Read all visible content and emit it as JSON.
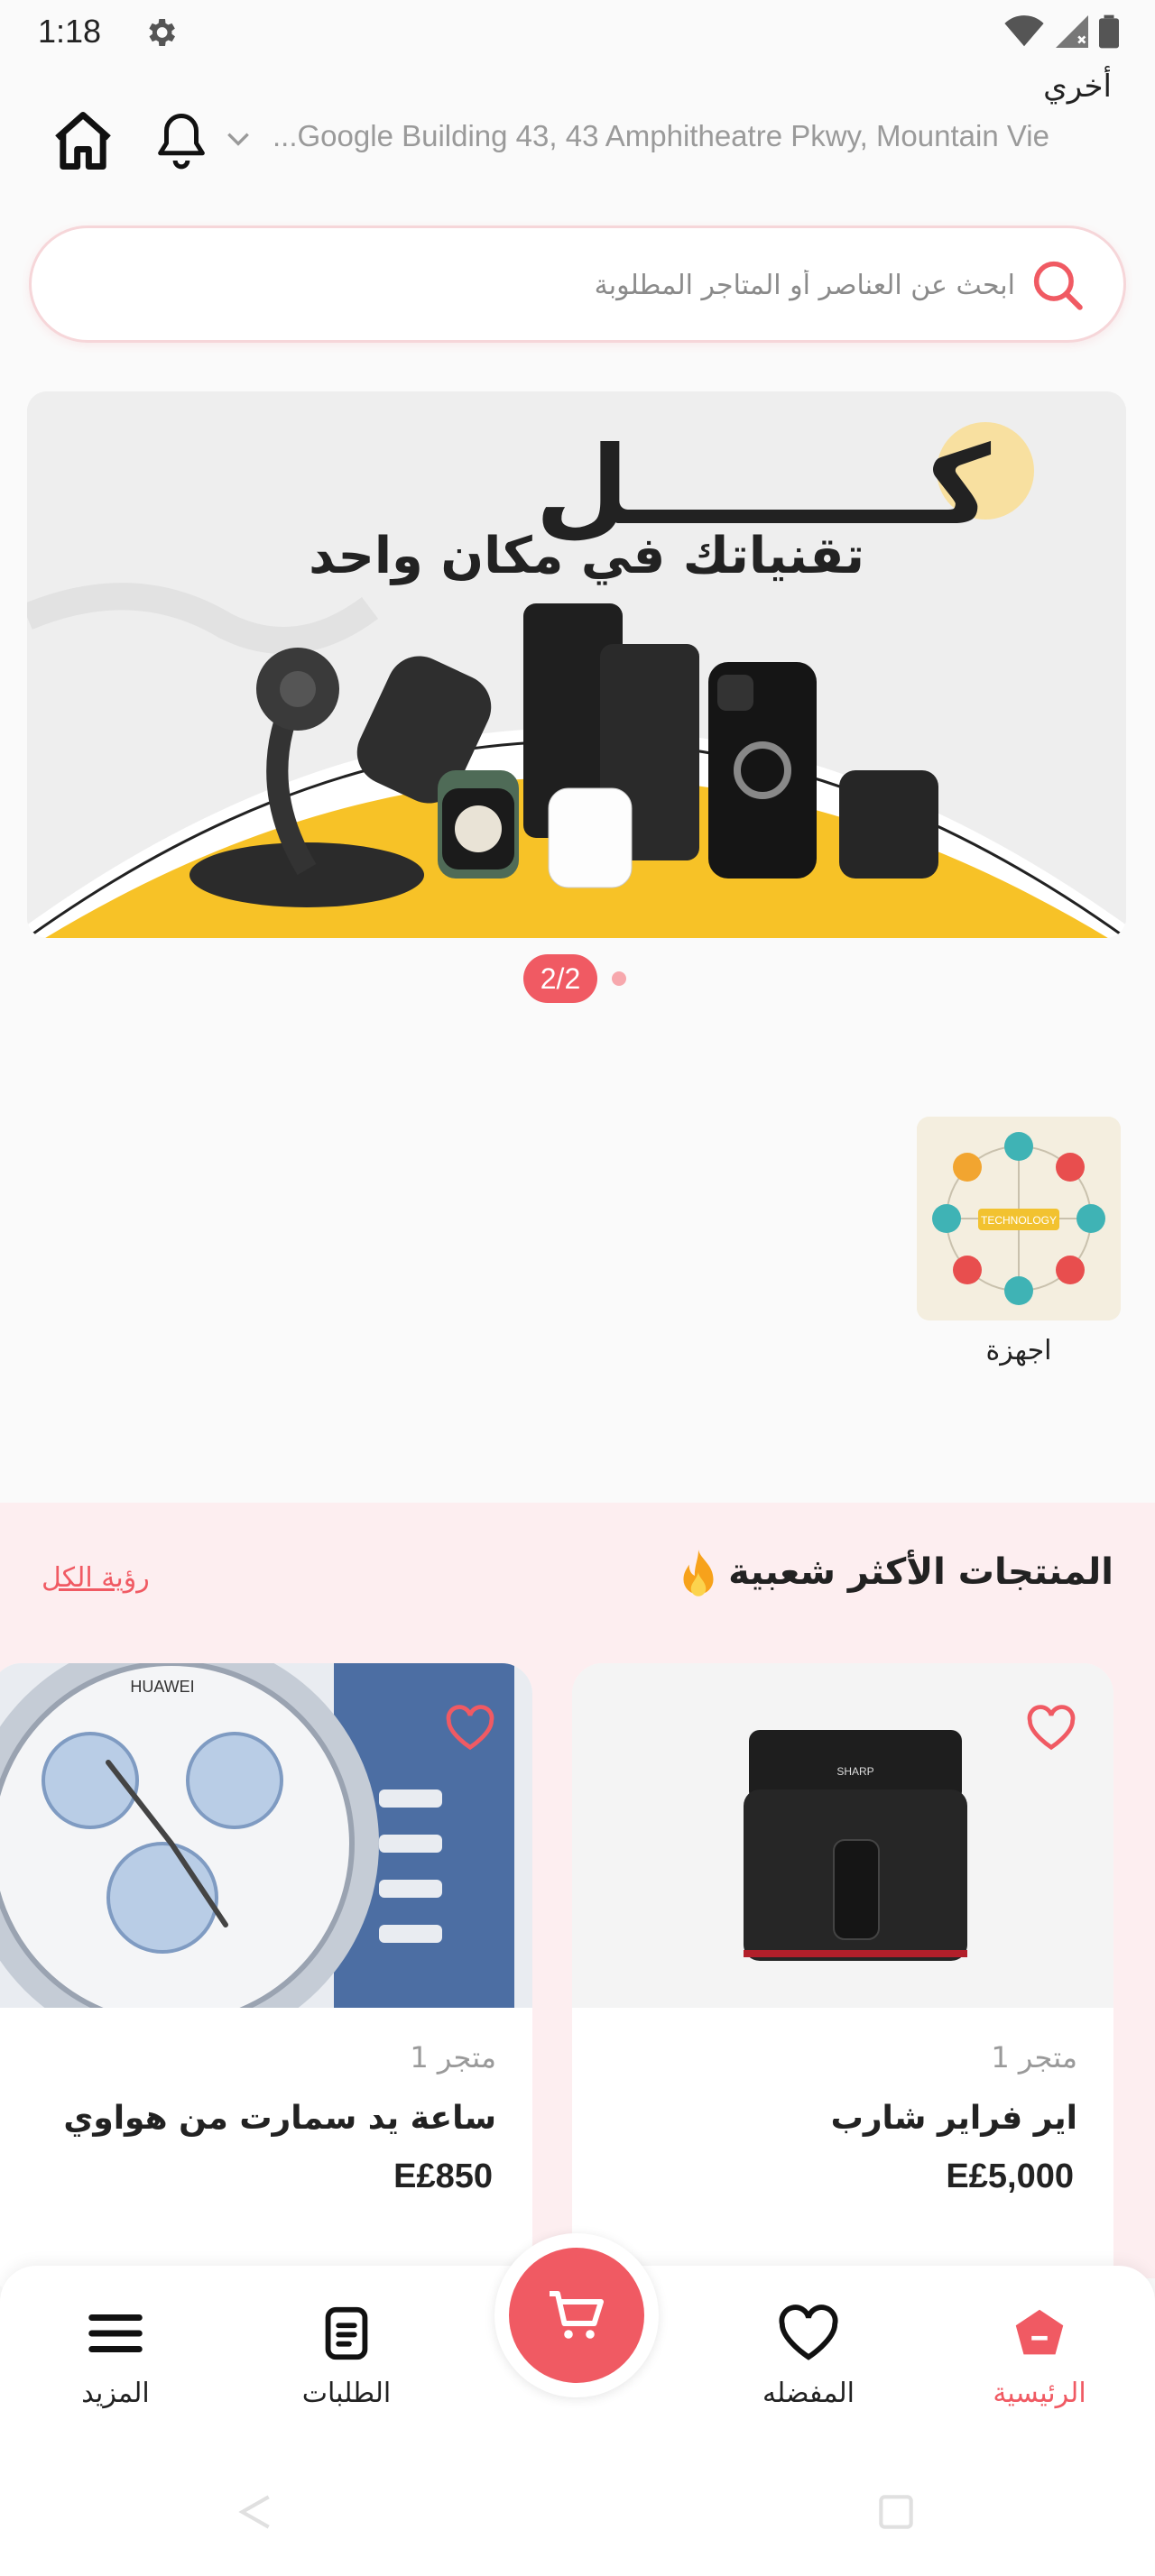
{
  "status_bar": {
    "time": "1:18"
  },
  "header": {
    "location_label": "أخري",
    "address": "...Google Building 43, 43 Amphitheatre Pkwy, Mountain Vie"
  },
  "search": {
    "placeholder": "ابحث عن العناصر أو المتاجر المطلوبة"
  },
  "banner": {
    "headline": "كــــــــل",
    "subline": "تقنياتك في مكان واحد",
    "page_indicator": "2/2"
  },
  "categories": [
    {
      "label": "اجهزة",
      "image_text": "TECHNOLOGY"
    }
  ],
  "popular": {
    "title": "المنتجات الأكثر شعبية",
    "see_all": "رؤية الكل",
    "products": [
      {
        "store": "متجر 1",
        "name": "اير  فراير شارب",
        "price": "E£5,000",
        "image_brand": "SHARP"
      },
      {
        "store": "متجر 1",
        "name": "ساعة يد سمارت من هواوي",
        "price": "E£850",
        "image_brand": "HUAWEI"
      }
    ]
  },
  "bottom_nav": {
    "home": "الرئيسية",
    "favorites": "المفضله",
    "orders": "الطلبات",
    "more": "المزيد"
  },
  "colors": {
    "accent": "#f05a63",
    "section_bg": "#fdeef0",
    "banner_yellow": "#f7c227"
  }
}
